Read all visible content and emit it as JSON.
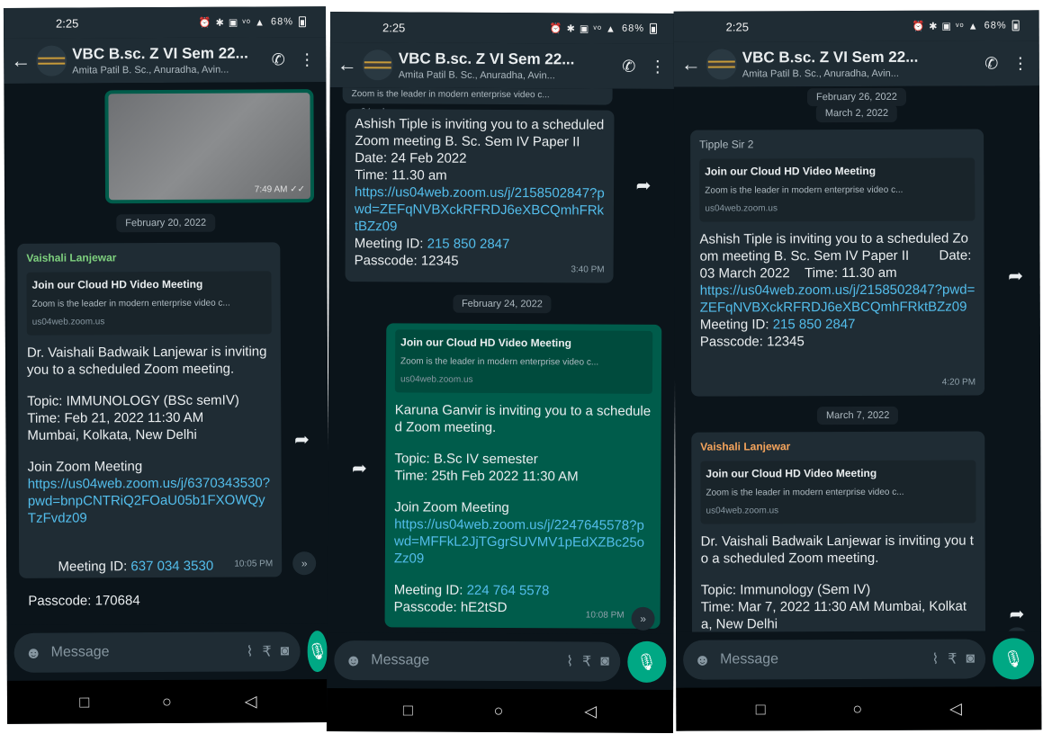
{
  "status": {
    "time": "2:25",
    "icons": "⏰ ✱ ▣ ᵛᵒ ▲",
    "battery": "68%"
  },
  "header": {
    "title": "VBC B.sc. Z VI Sem 22...",
    "participants": "Amita Patil B. Sc., Anuradha, Avin..."
  },
  "composer": {
    "placeholder": "Message"
  },
  "phone1": {
    "image_time": "7:49 AM ✓✓",
    "date1": "February 20, 2022",
    "msg": {
      "sender": "Vaishali Lanjewar",
      "preview_title": "Join our Cloud HD Video Meeting",
      "preview_desc": "Zoom is the leader in modern enterprise video c...",
      "preview_url": "us04web.zoom.us",
      "intro": "Dr. Vaishali Badwaik Lanjewar is inviting you to a scheduled Zoom meeting.",
      "topic": "Topic: IMMUNOLOGY (BSc semIV)\nTime: Feb 21, 2022 11:30 AM\nMumbai, Kolkata, New Delhi",
      "join": "Join Zoom Meeting",
      "link": "https://us04web.zoom.us/j/6370343530?pwd=bnpCNTRiQ2FOaU05b1FXOWQyTzFvdz09",
      "id_label": "Meeting ID: ",
      "id": "637 034 3530",
      "passcode": "Passcode: 170684",
      "time": "10:05 PM"
    }
  },
  "phone2": {
    "top_preview": "Zoom is the leader in modern enterprise video c...",
    "top_url": "us04web.zoom.us",
    "msg1": {
      "text": "Ashish Tiple is inviting you to a scheduled Zoom meeting B. Sc. Sem IV Paper II        Date: 24 Feb 2022\nTime: 11.30 am",
      "link": "https://us04web.zoom.us/j/2158502847?pwd=ZEFqNVBXckRFRDJ6eXBCQmhFRktBZz09",
      "id_label": "Meeting ID: ",
      "id": "215 850 2847",
      "passcode": "Passcode: 12345",
      "time": "3:40 PM"
    },
    "date": "February 24, 2022",
    "msg2": {
      "preview_title": "Join our Cloud HD Video Meeting",
      "preview_desc": "Zoom is the leader in modern enterprise video c...",
      "preview_url": "us04web.zoom.us",
      "intro": "Karuna Ganvir is inviting you to a scheduled Zoom meeting.",
      "topic": "Topic: B.Sc IV semester\nTime: 25th Feb 2022 11:30 AM",
      "join": "Join Zoom Meeting",
      "link": "https://us04web.zoom.us/j/2247645578?pwd=MFFkL2JjTGgrSUVMV1pEdXZBc25oZz09",
      "id_label": "Meeting ID: ",
      "id": "224 764 5578",
      "passcode": "Passcode: hE2tSD",
      "time": "10:08 PM"
    }
  },
  "phone3": {
    "date_a": "February 26, 2022",
    "date_b": "March 2, 2022",
    "msg1": {
      "sender": "Tipple Sir 2",
      "preview_title": "Join our Cloud HD Video Meeting",
      "preview_desc": "Zoom is the leader in modern enterprise video c...",
      "preview_url": "us04web.zoom.us",
      "text": "Ashish Tiple is inviting you to a scheduled Zoom meeting B. Sc. Sem IV Paper II        Date: 03 March 2022    Time: 11.30 am",
      "link": "https://us04web.zoom.us/j/2158502847?pwd=ZEFqNVBXckRFRDJ6eXBCQmhFRktBZz09",
      "id_label": "Meeting ID: ",
      "id": "215 850 2847",
      "passcode": "Passcode: 12345",
      "time": "4:20 PM"
    },
    "date_c": "March 7, 2022",
    "msg2": {
      "sender": "Vaishali Lanjewar",
      "preview_title": "Join our Cloud HD Video Meeting",
      "preview_desc": "Zoom is the leader in modern enterprise video c...",
      "preview_url": "us04web.zoom.us",
      "intro": "Dr. Vaishali Badwaik Lanjewar is inviting you to a scheduled Zoom meeting.",
      "topic": "Topic: Immunology (Sem IV)\nTime: Mar 7, 2022 11:30 AM Mumbai, Kolkata, New Delhi"
    }
  },
  "icons": {
    "back": "back-arrow-icon",
    "call": "add-call-icon",
    "menu": "more-vert-icon",
    "forward": "forward-icon",
    "emoji": "emoji-icon",
    "attach": "attach-icon",
    "rupee": "rupee-icon",
    "camera": "camera-icon",
    "mic": "mic-icon"
  },
  "colors": {
    "header": "#1f2c34",
    "background": "#0b141a",
    "outgoing": "#005c4b",
    "link": "#53bdeb",
    "mic": "#00a884"
  }
}
